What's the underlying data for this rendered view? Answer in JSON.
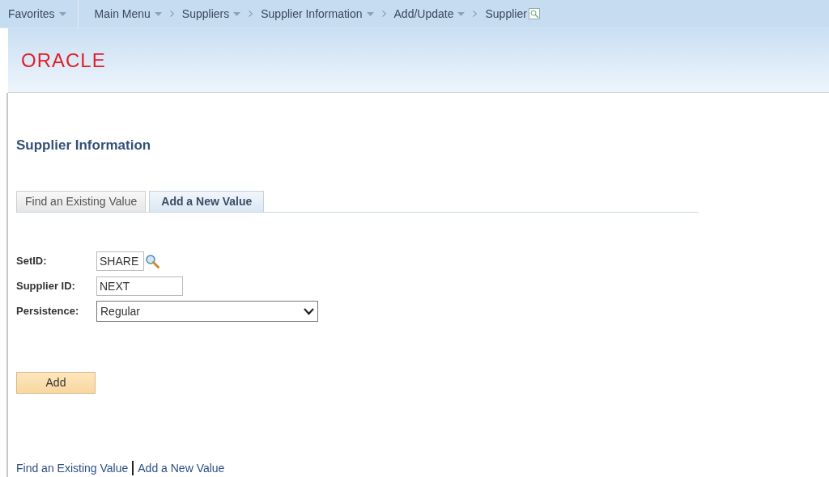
{
  "favorites": {
    "label": "Favorites",
    "dropdown": true
  },
  "breadcrumb": [
    {
      "label": "Main Menu",
      "dropdown": true
    },
    {
      "label": "Suppliers",
      "dropdown": true
    },
    {
      "label": "Supplier Information",
      "dropdown": true
    },
    {
      "label": "Add/Update",
      "dropdown": true
    },
    {
      "label": "Supplier",
      "dropdown": false
    }
  ],
  "logo": "ORACLE",
  "page_title": "Supplier Information",
  "tabs": [
    {
      "label": "Find an Existing Value",
      "selected": false
    },
    {
      "label": "Add a New Value",
      "selected": true
    }
  ],
  "fields": [
    {
      "kind": "lookup",
      "label": "SetID:",
      "value": "SHARE"
    },
    {
      "kind": "text",
      "label": "Supplier ID:",
      "value": "NEXT"
    },
    {
      "kind": "select",
      "label": "Persistence:",
      "value": "Regular"
    }
  ],
  "add_button": "Add",
  "footer_links": [
    "Find an Existing Value",
    "Add a New Value"
  ]
}
